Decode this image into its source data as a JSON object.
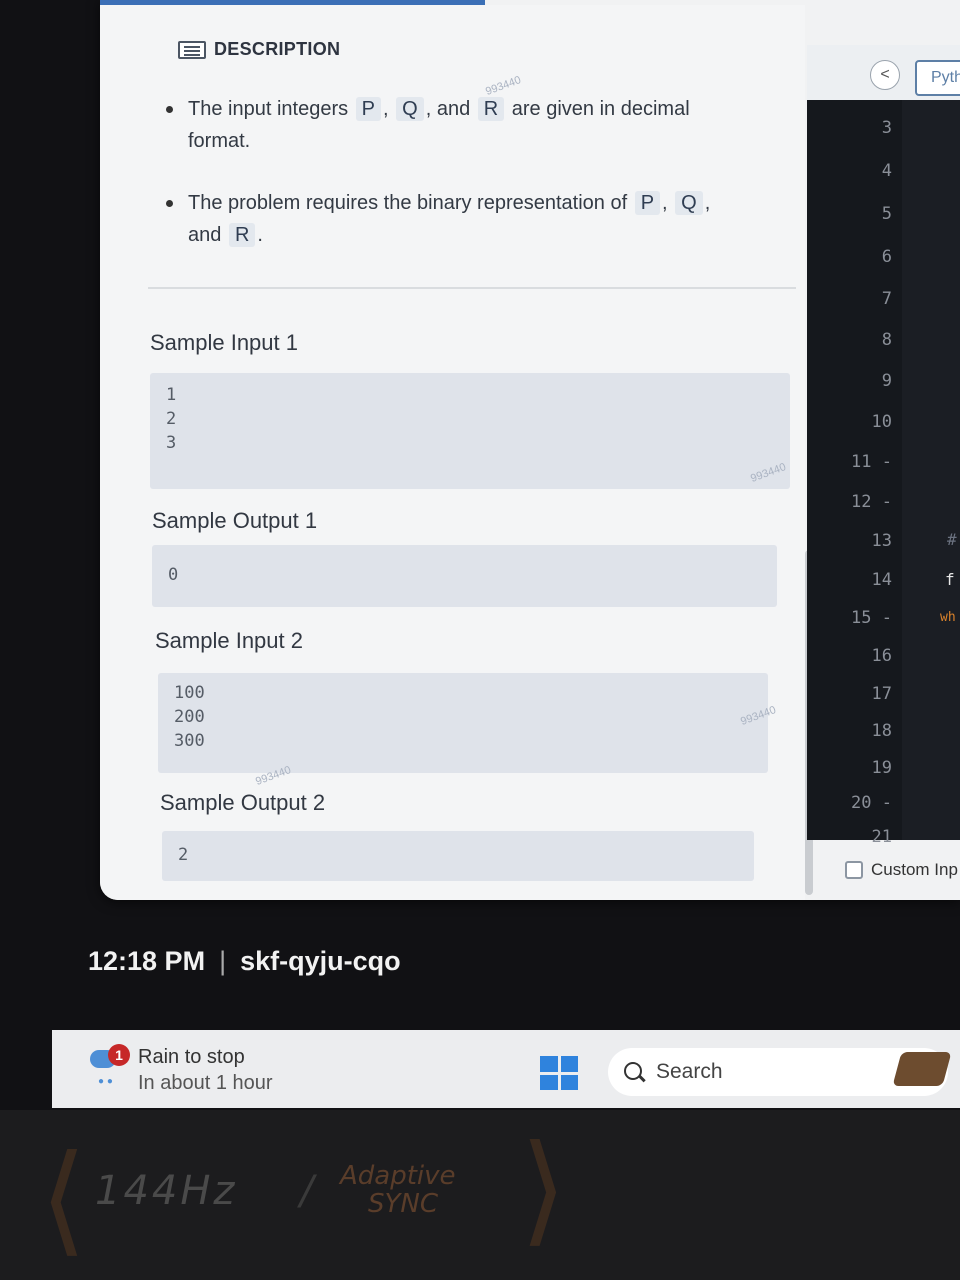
{
  "description": {
    "title": "DESCRIPTION",
    "bullet1": {
      "before": "The input integers",
      "p": "P",
      "comma1": ",",
      "q": "Q",
      "and": ", and",
      "r": "R",
      "after": "are given in decimal",
      "line2": "format."
    },
    "bullet2": {
      "before": "The problem requires the binary representation of",
      "p": "P",
      "comma1": ",",
      "q": "Q",
      "comma2": ",",
      "and": "and",
      "r": "R",
      "period": "."
    }
  },
  "samples": [
    {
      "label": "Sample Input 1",
      "content": "1\n2\n3"
    },
    {
      "label": "Sample Output 1",
      "content": "0"
    },
    {
      "label": "Sample Input 2",
      "content": "100\n200\n300"
    },
    {
      "label": "Sample Output 2",
      "content": "2"
    }
  ],
  "watermark": "993440",
  "editor": {
    "lang_label": "Pyth",
    "nav_back": "<",
    "line_numbers": [
      "3",
      "4",
      "5",
      "6",
      "7",
      "8",
      "9",
      "10",
      "11 -",
      "12 -",
      "13",
      "14",
      "15 -",
      "16",
      "17",
      "18",
      "19",
      "20 -",
      "21"
    ],
    "fragments": {
      "f": "f",
      "wh": "wh",
      "hash": "#"
    },
    "custom_input_label": "Custom Inp"
  },
  "status_bar": {
    "time": "12:18 PM",
    "separator": "|",
    "meeting_code": "skf-qyju-cqo"
  },
  "taskbar": {
    "weather_badge": "1",
    "weather_title": "Rain to stop",
    "weather_sub": "In about 1 hour",
    "search_label": "Search"
  },
  "bezel": {
    "refresh": "144Hz",
    "slash": "/",
    "sync_line1": "Adaptive",
    "sync_line2": "SYNC"
  }
}
